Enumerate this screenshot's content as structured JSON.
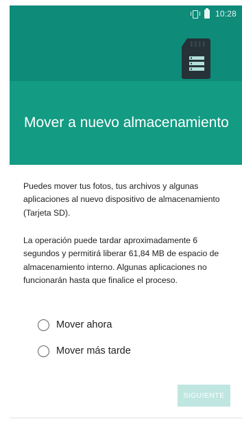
{
  "status_bar": {
    "time": "10:28",
    "icons": [
      "vibrate-icon",
      "battery-icon"
    ]
  },
  "header": {
    "title": "Mover a nuevo almacenamiento",
    "illustration": "sd-card-icon",
    "colors": {
      "top": "#0e8b79",
      "bottom": "#139b83"
    }
  },
  "body": {
    "paragraph_1": "Puedes mover tus fotos, tus archivos y algunas aplicaciones al nuevo dispositivo de almacenamiento (Tarjeta SD).",
    "paragraph_2": "La operación puede tardar aproximadamente 6 segundos y permitirá liberar 61,84 MB de espacio de almacenamiento interno. Algunas aplicaciones no funcionarán hasta que finalice el proceso."
  },
  "options": [
    {
      "label": "Mover ahora",
      "selected": false
    },
    {
      "label": "Mover más tarde",
      "selected": false
    }
  ],
  "footer": {
    "next_label": "SIGUIENTE",
    "next_enabled": false,
    "next_color": "#bfe6e0"
  }
}
